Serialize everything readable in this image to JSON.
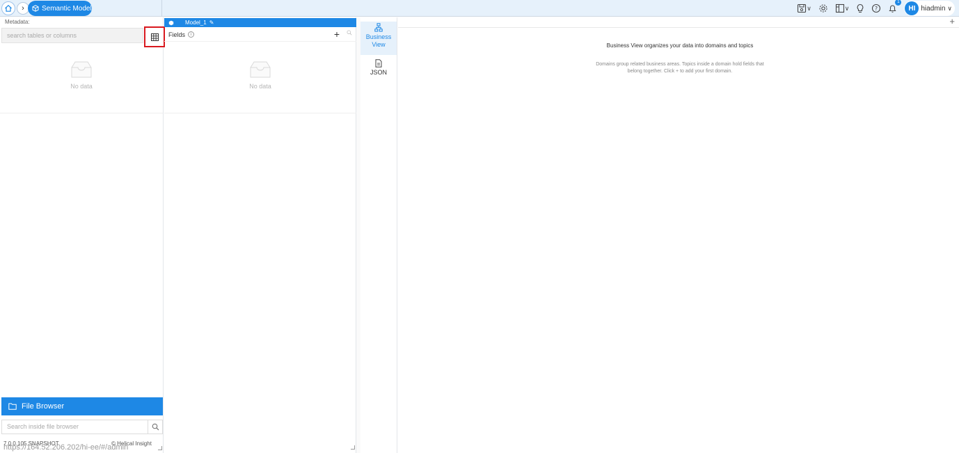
{
  "topbar": {
    "breadcrumb": "Semantic Model",
    "user_initials": "HI",
    "username": "hiadmin",
    "notification_count": "1"
  },
  "metadata": {
    "label": "Metadata:",
    "search_placeholder": "search tables or columns",
    "empty_text": "No data"
  },
  "file_browser": {
    "title": "File Browser",
    "search_placeholder": "Search inside file browser"
  },
  "footer": {
    "version": "7.0.0.105 SNAPSHOT",
    "url": "https://164.52.206.202/hi-ee/#/admin",
    "copyright": "© Helical Insight"
  },
  "model": {
    "tab_name": "Model_1",
    "fields_label": "Fields",
    "empty_text": "No data"
  },
  "views": [
    {
      "label": "Business View"
    },
    {
      "label": "JSON"
    }
  ],
  "business_view": {
    "title": "Business View organizes your data into domains and topics",
    "description": "Domains group related business areas. Topics inside a domain hold fields that belong together. Click + to add your first domain."
  },
  "colors": {
    "accent": "#1e88e5",
    "highlight_border": "#d9181e"
  }
}
